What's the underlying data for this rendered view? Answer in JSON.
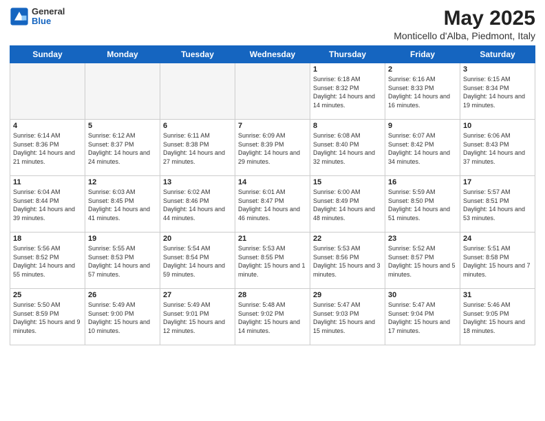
{
  "header": {
    "logo_general": "General",
    "logo_blue": "Blue",
    "month_year": "May 2025",
    "location": "Monticello d'Alba, Piedmont, Italy"
  },
  "weekdays": [
    "Sunday",
    "Monday",
    "Tuesday",
    "Wednesday",
    "Thursday",
    "Friday",
    "Saturday"
  ],
  "weeks": [
    [
      {
        "day": "",
        "empty": true
      },
      {
        "day": "",
        "empty": true
      },
      {
        "day": "",
        "empty": true
      },
      {
        "day": "",
        "empty": true
      },
      {
        "day": "1",
        "sunrise": "6:18 AM",
        "sunset": "8:32 PM",
        "daylight": "14 hours and 14 minutes."
      },
      {
        "day": "2",
        "sunrise": "6:16 AM",
        "sunset": "8:33 PM",
        "daylight": "14 hours and 16 minutes."
      },
      {
        "day": "3",
        "sunrise": "6:15 AM",
        "sunset": "8:34 PM",
        "daylight": "14 hours and 19 minutes."
      }
    ],
    [
      {
        "day": "4",
        "sunrise": "6:14 AM",
        "sunset": "8:36 PM",
        "daylight": "14 hours and 21 minutes."
      },
      {
        "day": "5",
        "sunrise": "6:12 AM",
        "sunset": "8:37 PM",
        "daylight": "14 hours and 24 minutes."
      },
      {
        "day": "6",
        "sunrise": "6:11 AM",
        "sunset": "8:38 PM",
        "daylight": "14 hours and 27 minutes."
      },
      {
        "day": "7",
        "sunrise": "6:09 AM",
        "sunset": "8:39 PM",
        "daylight": "14 hours and 29 minutes."
      },
      {
        "day": "8",
        "sunrise": "6:08 AM",
        "sunset": "8:40 PM",
        "daylight": "14 hours and 32 minutes."
      },
      {
        "day": "9",
        "sunrise": "6:07 AM",
        "sunset": "8:42 PM",
        "daylight": "14 hours and 34 minutes."
      },
      {
        "day": "10",
        "sunrise": "6:06 AM",
        "sunset": "8:43 PM",
        "daylight": "14 hours and 37 minutes."
      }
    ],
    [
      {
        "day": "11",
        "sunrise": "6:04 AM",
        "sunset": "8:44 PM",
        "daylight": "14 hours and 39 minutes."
      },
      {
        "day": "12",
        "sunrise": "6:03 AM",
        "sunset": "8:45 PM",
        "daylight": "14 hours and 41 minutes."
      },
      {
        "day": "13",
        "sunrise": "6:02 AM",
        "sunset": "8:46 PM",
        "daylight": "14 hours and 44 minutes."
      },
      {
        "day": "14",
        "sunrise": "6:01 AM",
        "sunset": "8:47 PM",
        "daylight": "14 hours and 46 minutes."
      },
      {
        "day": "15",
        "sunrise": "6:00 AM",
        "sunset": "8:49 PM",
        "daylight": "14 hours and 48 minutes."
      },
      {
        "day": "16",
        "sunrise": "5:59 AM",
        "sunset": "8:50 PM",
        "daylight": "14 hours and 51 minutes."
      },
      {
        "day": "17",
        "sunrise": "5:57 AM",
        "sunset": "8:51 PM",
        "daylight": "14 hours and 53 minutes."
      }
    ],
    [
      {
        "day": "18",
        "sunrise": "5:56 AM",
        "sunset": "8:52 PM",
        "daylight": "14 hours and 55 minutes."
      },
      {
        "day": "19",
        "sunrise": "5:55 AM",
        "sunset": "8:53 PM",
        "daylight": "14 hours and 57 minutes."
      },
      {
        "day": "20",
        "sunrise": "5:54 AM",
        "sunset": "8:54 PM",
        "daylight": "14 hours and 59 minutes."
      },
      {
        "day": "21",
        "sunrise": "5:53 AM",
        "sunset": "8:55 PM",
        "daylight": "15 hours and 1 minute."
      },
      {
        "day": "22",
        "sunrise": "5:53 AM",
        "sunset": "8:56 PM",
        "daylight": "15 hours and 3 minutes."
      },
      {
        "day": "23",
        "sunrise": "5:52 AM",
        "sunset": "8:57 PM",
        "daylight": "15 hours and 5 minutes."
      },
      {
        "day": "24",
        "sunrise": "5:51 AM",
        "sunset": "8:58 PM",
        "daylight": "15 hours and 7 minutes."
      }
    ],
    [
      {
        "day": "25",
        "sunrise": "5:50 AM",
        "sunset": "8:59 PM",
        "daylight": "15 hours and 9 minutes."
      },
      {
        "day": "26",
        "sunrise": "5:49 AM",
        "sunset": "9:00 PM",
        "daylight": "15 hours and 10 minutes."
      },
      {
        "day": "27",
        "sunrise": "5:49 AM",
        "sunset": "9:01 PM",
        "daylight": "15 hours and 12 minutes."
      },
      {
        "day": "28",
        "sunrise": "5:48 AM",
        "sunset": "9:02 PM",
        "daylight": "15 hours and 14 minutes."
      },
      {
        "day": "29",
        "sunrise": "5:47 AM",
        "sunset": "9:03 PM",
        "daylight": "15 hours and 15 minutes."
      },
      {
        "day": "30",
        "sunrise": "5:47 AM",
        "sunset": "9:04 PM",
        "daylight": "15 hours and 17 minutes."
      },
      {
        "day": "31",
        "sunrise": "5:46 AM",
        "sunset": "9:05 PM",
        "daylight": "15 hours and 18 minutes."
      }
    ]
  ]
}
